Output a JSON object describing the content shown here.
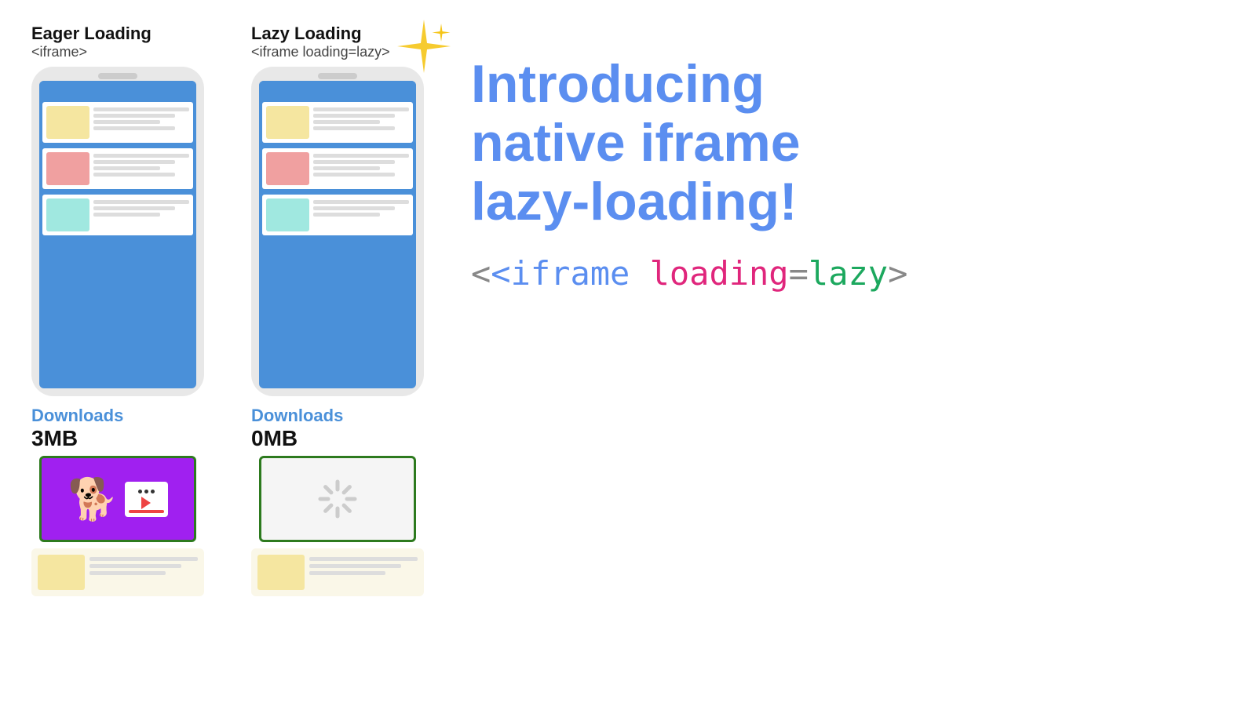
{
  "eager": {
    "title": "Eager Loading",
    "code": "<iframe>",
    "downloads_label": "Downloads",
    "downloads_size": "3MB",
    "cards": [
      {
        "thumb_color": "#f5e6a0",
        "thumb_w": 55,
        "thumb_h": 42
      },
      {
        "thumb_color": "#f0a0a0",
        "thumb_w": 55,
        "thumb_h": 42
      },
      {
        "thumb_color": "#a0e8e0",
        "thumb_w": 55,
        "thumb_h": 42
      }
    ]
  },
  "lazy": {
    "title": "Lazy Loading",
    "code": "<iframe loading=lazy>",
    "downloads_label": "Downloads",
    "downloads_size": "0MB",
    "cards": [
      {
        "thumb_color": "#f5e6a0",
        "thumb_w": 55,
        "thumb_h": 42
      },
      {
        "thumb_color": "#f0a0a0",
        "thumb_w": 55,
        "thumb_h": 42
      },
      {
        "thumb_color": "#a0e8e0",
        "thumb_w": 55,
        "thumb_h": 42
      }
    ]
  },
  "headline": "Introducing\nnative iframe\nlazy-loading!",
  "code_snippet": {
    "prefix": "<iframe ",
    "attr_name": "loading",
    "equals": "=",
    "attr_value": "lazy",
    "suffix": ">"
  },
  "sparkle": "✦"
}
